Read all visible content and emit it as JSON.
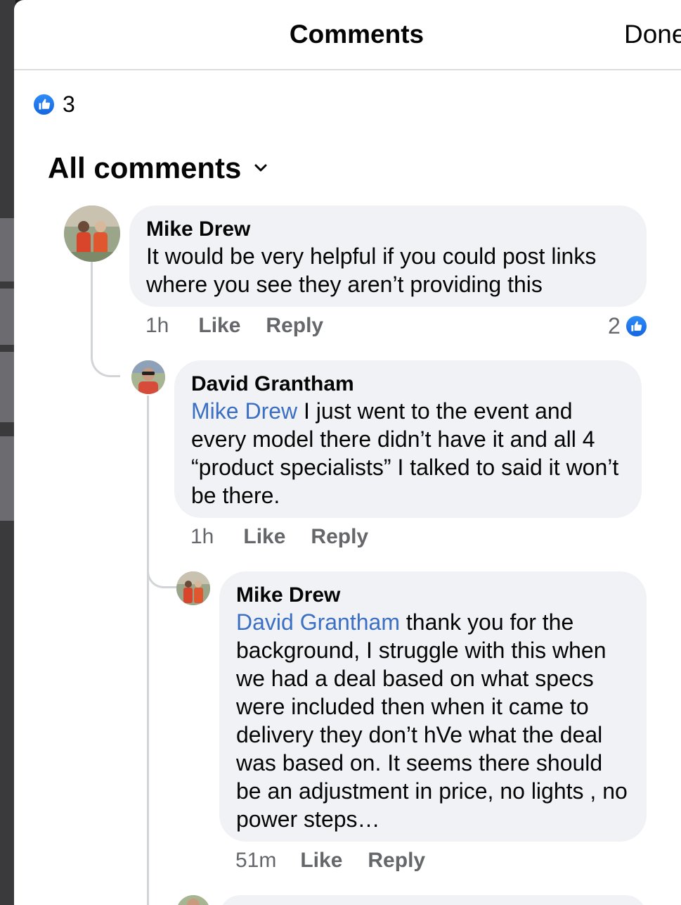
{
  "header": {
    "title": "Comments",
    "done_label": "Done"
  },
  "reactions": {
    "icon": "like-icon",
    "count": "3"
  },
  "filter": {
    "label": "All comments",
    "icon": "chevron-down-icon"
  },
  "comments": [
    {
      "author": "Mike Drew",
      "mention": "",
      "text": "It would be very helpful if you could post links where you see they aren’t providing this",
      "time": "1h",
      "like_label": "Like",
      "reply_label": "Reply",
      "likes": "2"
    },
    {
      "author": "David Grantham",
      "mention": "Mike Drew",
      "text": " I just went to the event and every model there didn’t have it and all 4 “product specialists” I talked to said it won’t be there.",
      "time": "1h",
      "like_label": "Like",
      "reply_label": "Reply"
    },
    {
      "author": "Mike Drew",
      "mention": "David Grantham",
      "text": " thank you for the background, I struggle with this when we had a deal based on what specs were included then when it came to delivery they don’t hVe what the deal was based on. It seems there should be an adjustment in price, no lights , no power steps…",
      "time": "51m",
      "like_label": "Like",
      "reply_label": "Reply"
    }
  ],
  "colors": {
    "mention": "#3b6fc4",
    "like_blue": "#1877f2",
    "bubble_bg": "#f0f2f5",
    "meta_gray": "#65676b"
  }
}
